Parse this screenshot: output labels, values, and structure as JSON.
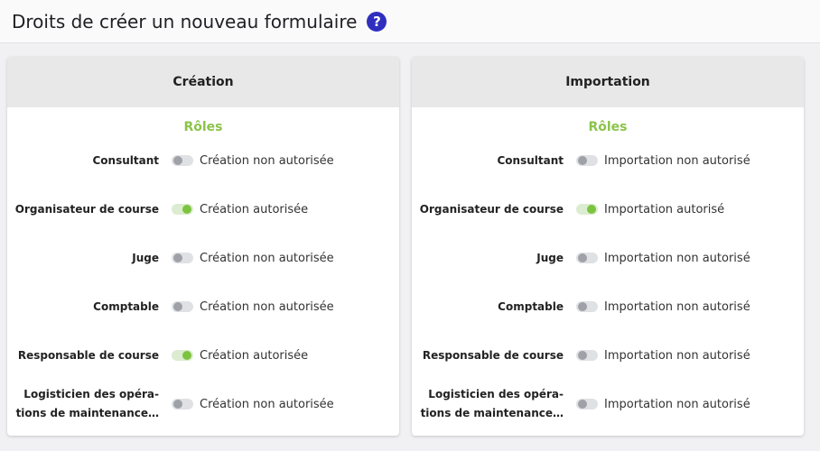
{
  "header": {
    "title": "Droits de créer un nouveau formulaire",
    "help_glyph": "?"
  },
  "accent_color": "#8bc34a",
  "toggle_on_color": "#7cc340",
  "help_icon_color": "#2f2fbf",
  "cards": [
    {
      "title": "Création",
      "roles_title": "Rôles",
      "rows": [
        {
          "role": "Consultant",
          "enabled": false,
          "status": "Création non autorisée"
        },
        {
          "role": "Organisateur de course",
          "enabled": true,
          "status": "Création autorisée"
        },
        {
          "role": "Juge",
          "enabled": false,
          "status": "Création non autorisée"
        },
        {
          "role": "Comptable",
          "enabled": false,
          "status": "Création non autorisée"
        },
        {
          "role": "Responsable de course",
          "enabled": true,
          "status": "Création autorisée"
        },
        {
          "role": "Logisticien des opéra-\ntions de maintenance…",
          "enabled": false,
          "status": "Création non autorisée"
        }
      ]
    },
    {
      "title": "Importation",
      "roles_title": "Rôles",
      "rows": [
        {
          "role": "Consultant",
          "enabled": false,
          "status": "Importation non autorisé"
        },
        {
          "role": "Organisateur de course",
          "enabled": true,
          "status": "Importation autorisé"
        },
        {
          "role": "Juge",
          "enabled": false,
          "status": "Importation non autorisé"
        },
        {
          "role": "Comptable",
          "enabled": false,
          "status": "Importation non autorisé"
        },
        {
          "role": "Responsable de course",
          "enabled": false,
          "status": "Importation non autorisé"
        },
        {
          "role": "Logisticien des opéra-\ntions de maintenance…",
          "enabled": false,
          "status": "Importation non autorisé"
        }
      ]
    }
  ]
}
